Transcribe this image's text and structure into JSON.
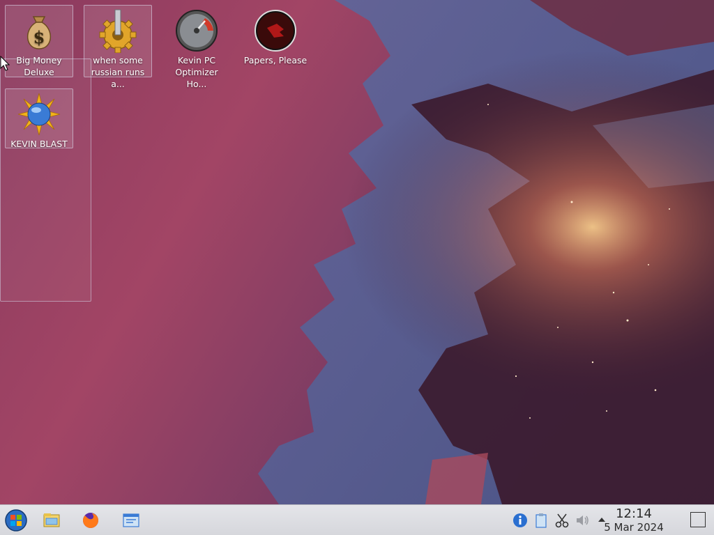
{
  "desktop": {
    "icons": [
      {
        "label": "Big Money Deluxe"
      },
      {
        "label": "when some russian runs a..."
      },
      {
        "label": "Kevin PC Optimizer Ho..."
      },
      {
        "label": "Papers, Please"
      },
      {
        "label": "KEVIN BLAST"
      }
    ]
  },
  "taskbar": {
    "start_icon": "start-orb-icon",
    "pinned": [
      "file-manager-icon",
      "firefox-icon",
      "system-settings-icon"
    ],
    "tray": [
      "info-icon",
      "clipboard-icon",
      "scissors-icon",
      "volume-muted-icon",
      "expand-tray-icon"
    ],
    "clock": {
      "time": "12:14",
      "date": "5 Mar 2024"
    }
  },
  "colors": {
    "taskbar": "#dfe0e4",
    "accent": "#3a7bd5"
  }
}
